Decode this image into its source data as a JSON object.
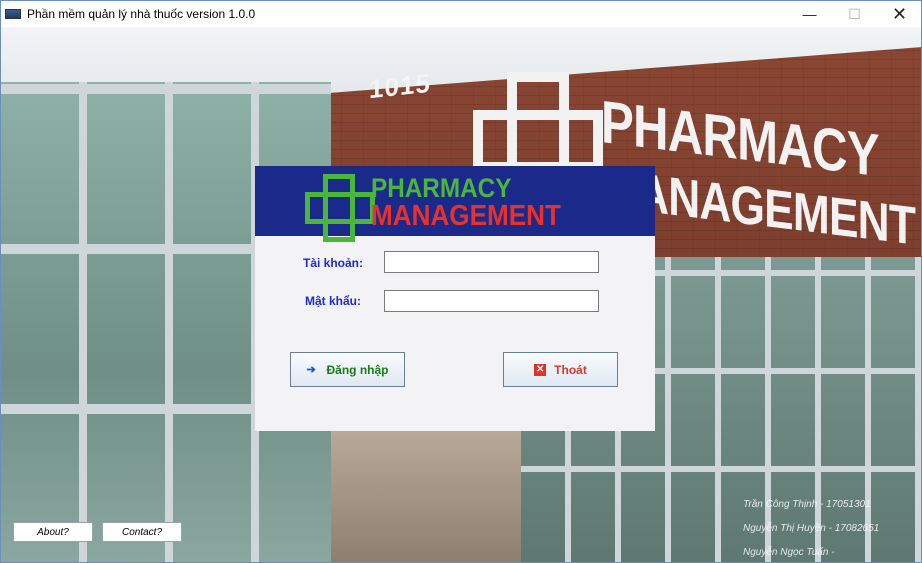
{
  "window": {
    "title": "Phần mềm quản lý nhà thuốc version 1.0.0",
    "minimize_glyph": "—",
    "maximize_glyph": "☐",
    "close_glyph": "✕"
  },
  "background": {
    "building_number": "1015",
    "sign_line1": "PHARMACY",
    "sign_line2": "MANAGEMENT"
  },
  "login": {
    "logo_line1": "PHARMACY",
    "logo_line2": "MANAGEMENT",
    "account_label": "Tài khoản:",
    "account_value": "",
    "password_label": "Mật khẩu:",
    "password_value": "",
    "login_button": "Đăng nhập",
    "exit_button": "Thoát",
    "login_icon": "arrow-right-icon",
    "exit_icon": "close-icon"
  },
  "credits": [
    "Trần Công Thịnh - 17051301",
    "Nguyễn Thị Huyền - 17082651",
    "Nguyễn Ngọc Tuấn -"
  ],
  "footer": {
    "about_button": "About?",
    "contact_button": "Contact?"
  },
  "colors": {
    "banner": "#1b2a8a",
    "logo_green": "#49b83a",
    "logo_red": "#e8312a",
    "label_blue": "#1c2bd6"
  }
}
